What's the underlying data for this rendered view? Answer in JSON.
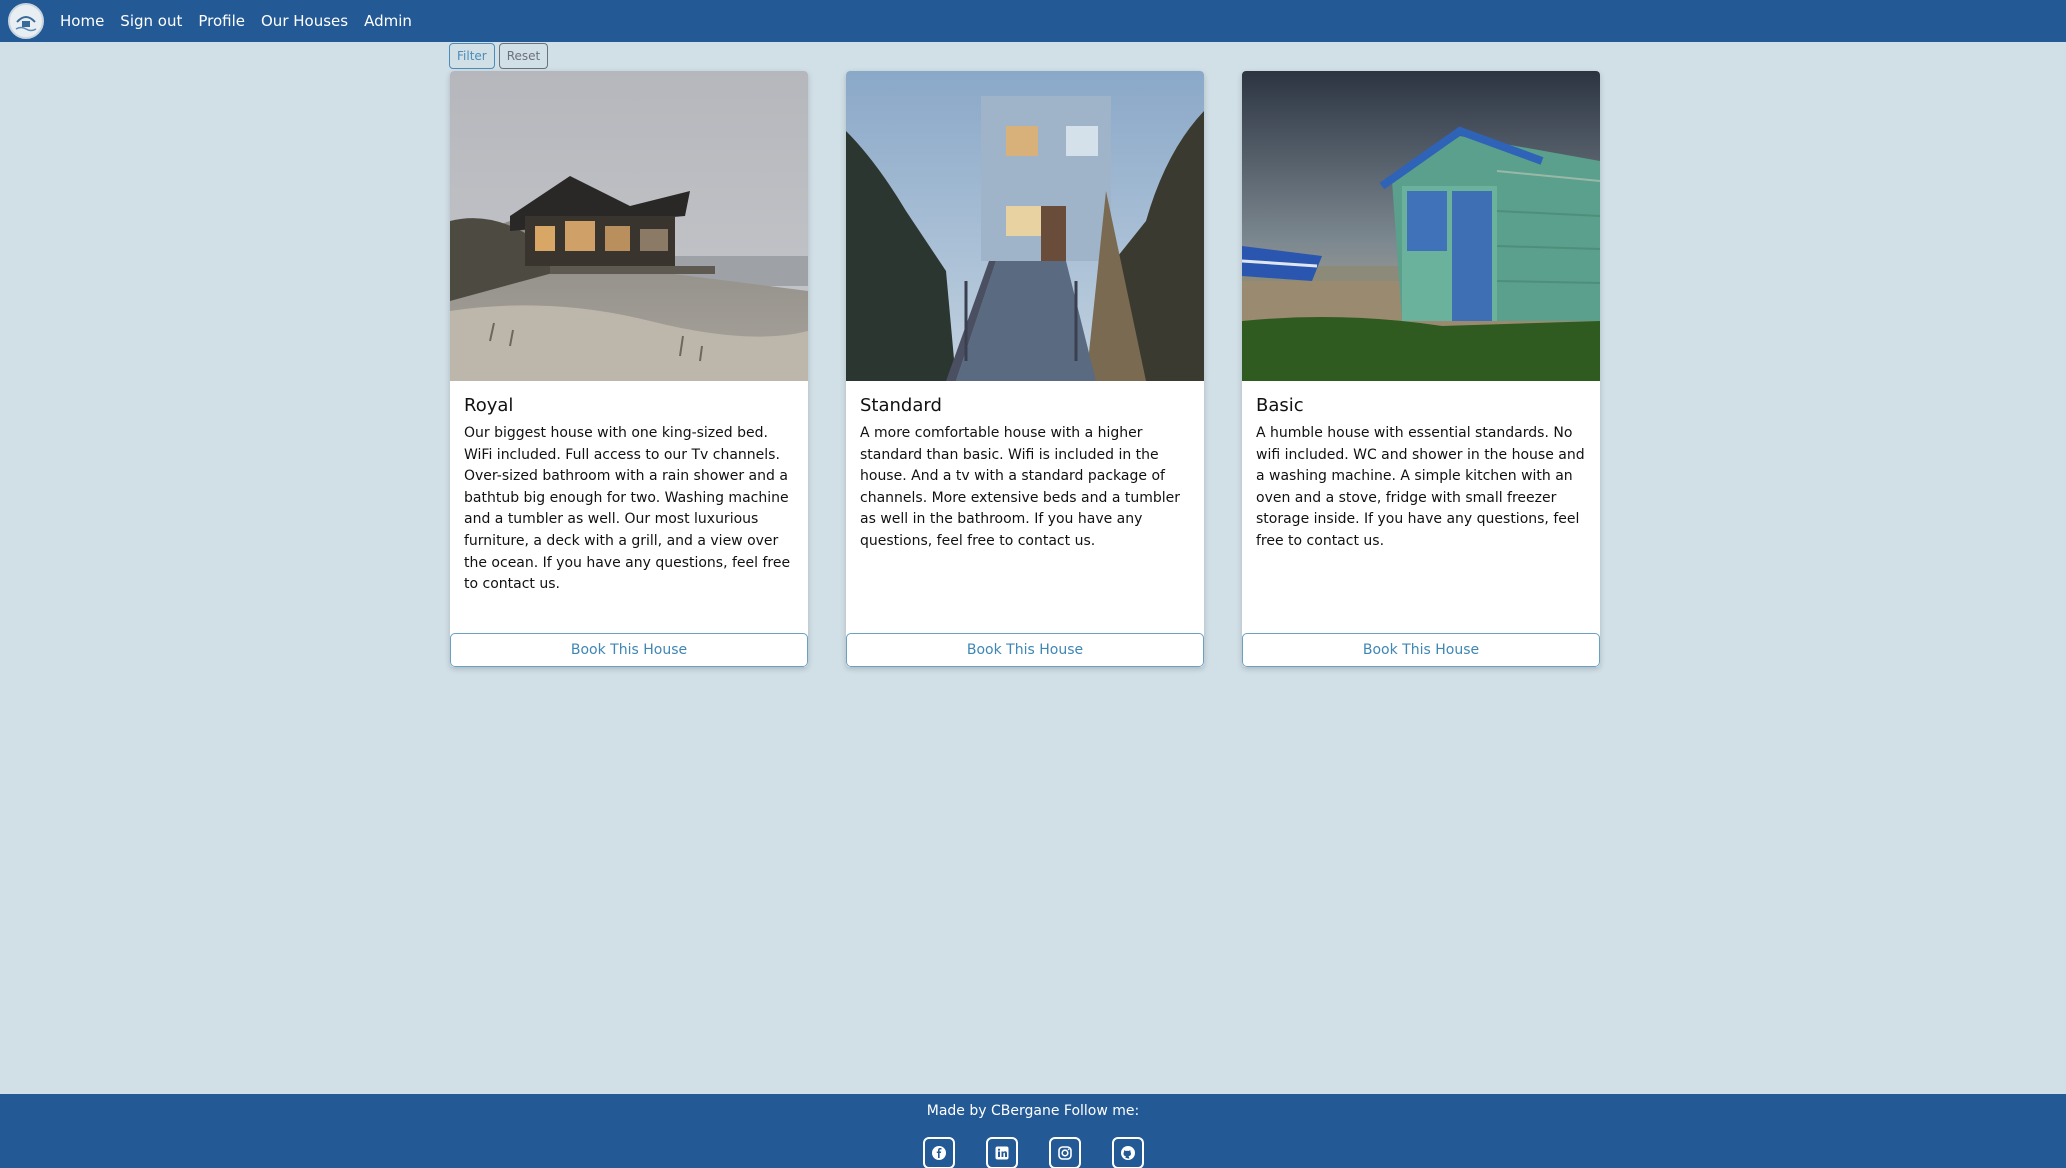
{
  "nav": {
    "logo_icon": "beach-house-logo-icon",
    "links": [
      {
        "label": "Home"
      },
      {
        "label": "Sign out"
      },
      {
        "label": "Profile"
      },
      {
        "label": "Our Houses"
      },
      {
        "label": "Admin"
      }
    ]
  },
  "filter": {
    "filter_label": "Filter",
    "reset_label": "Reset"
  },
  "houses": [
    {
      "title": "Royal",
      "description": "Our biggest house with one king-sized bed. WiFi included. Full access to our Tv channels. Over-sized bathroom with a rain shower and a bathtub big enough for two. Washing machine and a tumbler as well. Our most luxurious furniture, a deck with a grill, and a view over the ocean. If you have any questions, feel free to contact us.",
      "button": "Book This House"
    },
    {
      "title": "Standard",
      "description": "A more comfortable house with a higher standard than basic. Wifi is included in the house. And a tv with a standard package of channels. More extensive beds and a tumbler as well in the bathroom. If you have any questions, feel free to contact us.",
      "button": "Book This House"
    },
    {
      "title": "Basic",
      "description": "A humble house with essential standards. No wifi included. WC and shower in the house and a washing machine. A simple kitchen with an oven and a stove, fridge with small freezer storage inside. If you have any questions, feel free to contact us.",
      "button": "Book This House"
    }
  ],
  "footer": {
    "text": "Made by CBergane Follow me:",
    "social": [
      "facebook-icon",
      "linkedin-icon",
      "instagram-icon",
      "github-icon"
    ]
  },
  "colors": {
    "navbar": "#235a95",
    "background": "#d1dfe7",
    "accent": "#3e86b4"
  }
}
